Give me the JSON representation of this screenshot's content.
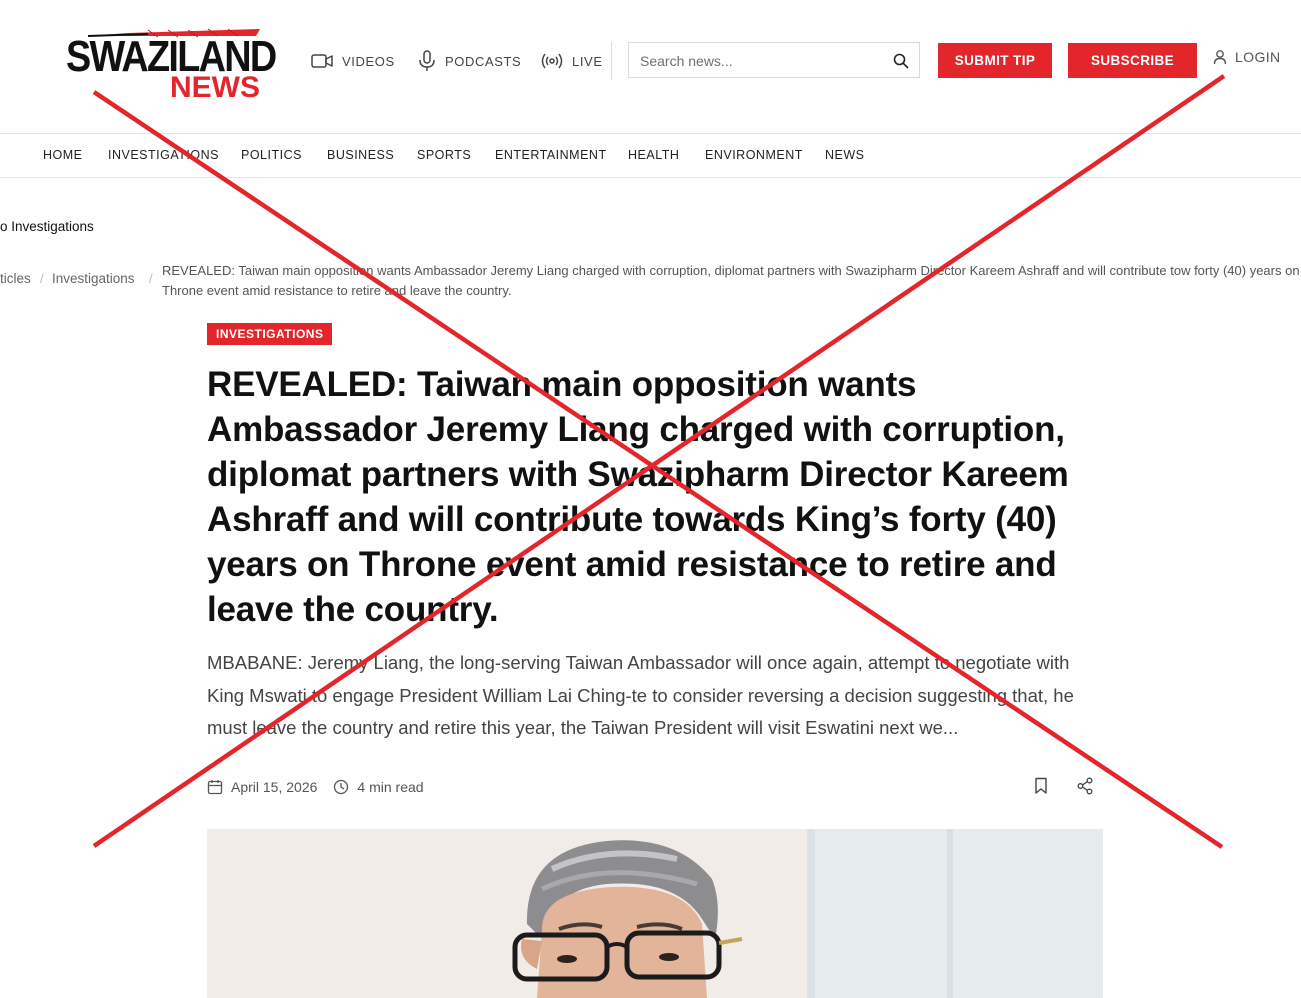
{
  "brand": {
    "name_top": "SWAZILAND",
    "name_bottom": "NEWS",
    "accent": "#e3262c"
  },
  "header": {
    "media_links": [
      {
        "label": "VIDEOS",
        "icon": "video-camera-icon"
      },
      {
        "label": "PODCASTS",
        "icon": "microphone-icon"
      },
      {
        "label": "LIVE",
        "icon": "broadcast-icon"
      }
    ],
    "search": {
      "placeholder": "Search news...",
      "value": ""
    },
    "submit_tip_label": "SUBMIT TIP",
    "subscribe_label": "SUBSCRIBE",
    "login_label": "LOGIN"
  },
  "nav": {
    "items": [
      "HOME",
      "INVESTIGATIONS",
      "POLITICS",
      "BUSINESS",
      "SPORTS",
      "ENTERTAINMENT",
      "HEALTH",
      "ENVIRONMENT",
      "NEWS"
    ]
  },
  "back_link": "o Investigations",
  "breadcrumb": {
    "items": [
      "ticles",
      "Investigations"
    ],
    "separator": "/",
    "current": "REVEALED: Taiwan main opposition wants Ambassador Jeremy Liang charged with corruption, diplomat partners with Swazipharm Director Kareem Ashraff and will contribute tow forty (40) years on Throne event amid resistance to retire and leave the country."
  },
  "article": {
    "category": "INVESTIGATIONS",
    "title": "REVEALED: Taiwan main opposition wants Ambassador Jeremy Liang charged with corruption, diplomat partners with Swazipharm Director Kareem Ashraff and will contribute towards King’s forty (40) years on Throne event amid resistance to retire and leave the country.",
    "excerpt": "MBABANE: Jeremy Liang, the long-serving Taiwan Ambassador will once again, attempt to negotiate with King Mswati to engage President William Lai Ching-te to consider reversing a decision suggesting that, he must leave the country and retire this year, the Taiwan President will visit Eswatini next we...",
    "date": "April 15, 2026",
    "read_time": "4 min read",
    "icons": {
      "date": "calendar-icon",
      "read_time": "clock-icon",
      "bookmark": "bookmark-icon",
      "share": "share-icon"
    }
  },
  "overlay": {
    "color": "#e3262c",
    "shape": "cross-out-x"
  }
}
